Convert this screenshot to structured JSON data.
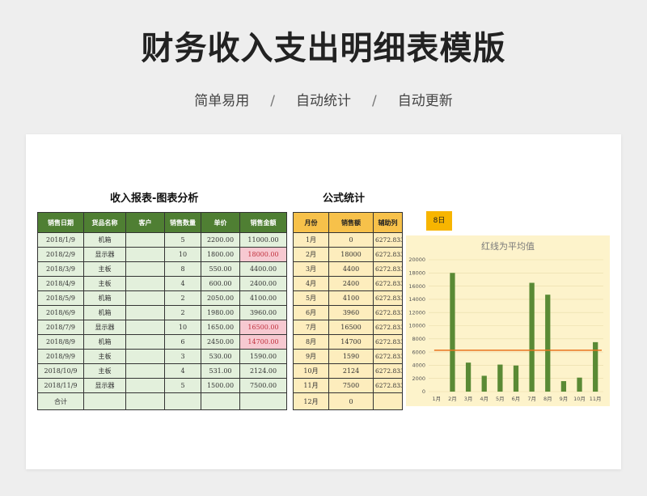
{
  "header": {
    "title": "财务收入支出明细表模版",
    "tags": [
      "简单易用",
      "自动统计",
      "自动更新"
    ],
    "separator": "/"
  },
  "sales_section": {
    "title": "收入报表-图表分析",
    "columns": [
      "销售日期",
      "货品名称",
      "客户",
      "销售数量",
      "单价",
      "销售金额"
    ],
    "rows": [
      {
        "date": "2018/1/9",
        "item": "机箱",
        "customer": "",
        "qty": "5",
        "price": "2200.00",
        "amount": "11000.00",
        "highlight": false
      },
      {
        "date": "2018/2/9",
        "item": "显示器",
        "customer": "",
        "qty": "10",
        "price": "1800.00",
        "amount": "18000.00",
        "highlight": true
      },
      {
        "date": "2018/3/9",
        "item": "主板",
        "customer": "",
        "qty": "8",
        "price": "550.00",
        "amount": "4400.00",
        "highlight": false
      },
      {
        "date": "2018/4/9",
        "item": "主板",
        "customer": "",
        "qty": "4",
        "price": "600.00",
        "amount": "2400.00",
        "highlight": false
      },
      {
        "date": "2018/5/9",
        "item": "机箱",
        "customer": "",
        "qty": "2",
        "price": "2050.00",
        "amount": "4100.00",
        "highlight": false
      },
      {
        "date": "2018/6/9",
        "item": "机箱",
        "customer": "",
        "qty": "2",
        "price": "1980.00",
        "amount": "3960.00",
        "highlight": false
      },
      {
        "date": "2018/7/9",
        "item": "显示器",
        "customer": "",
        "qty": "10",
        "price": "1650.00",
        "amount": "16500.00",
        "highlight": true
      },
      {
        "date": "2018/8/9",
        "item": "机箱",
        "customer": "",
        "qty": "6",
        "price": "2450.00",
        "amount": "14700.00",
        "highlight": true
      },
      {
        "date": "2018/9/9",
        "item": "主板",
        "customer": "",
        "qty": "3",
        "price": "530.00",
        "amount": "1590.00",
        "highlight": false
      },
      {
        "date": "2018/10/9",
        "item": "主板",
        "customer": "",
        "qty": "4",
        "price": "531.00",
        "amount": "2124.00",
        "highlight": false
      },
      {
        "date": "2018/11/9",
        "item": "显示器",
        "customer": "",
        "qty": "5",
        "price": "1500.00",
        "amount": "7500.00",
        "highlight": false
      }
    ],
    "total_label": "合计"
  },
  "formula_section": {
    "title": "公式统计",
    "columns": [
      "月份",
      "销售额",
      "辅助列"
    ],
    "rows": [
      {
        "month": "1月",
        "sales": "0",
        "aux": "6272.833"
      },
      {
        "month": "2月",
        "sales": "18000",
        "aux": "6272.833"
      },
      {
        "month": "3月",
        "sales": "4400",
        "aux": "6272.833"
      },
      {
        "month": "4月",
        "sales": "2400",
        "aux": "6272.833"
      },
      {
        "month": "5月",
        "sales": "4100",
        "aux": "6272.833"
      },
      {
        "month": "6月",
        "sales": "3960",
        "aux": "6272.833"
      },
      {
        "month": "7月",
        "sales": "16500",
        "aux": "6272.833"
      },
      {
        "month": "8月",
        "sales": "14700",
        "aux": "6272.833"
      },
      {
        "month": "9月",
        "sales": "1590",
        "aux": "6272.833"
      },
      {
        "month": "10月",
        "sales": "2124",
        "aux": "6272.833"
      },
      {
        "month": "11月",
        "sales": "7500",
        "aux": "6272.833"
      },
      {
        "month": "12月",
        "sales": "0",
        "aux": ""
      }
    ]
  },
  "month_badge": "8日",
  "colors": {
    "bar": "#5a8a35",
    "avg_line": "#e8731c",
    "chart_bg": "#fdf3cb",
    "sales_header": "#4f7f33",
    "formula_header": "#f7c14a"
  },
  "chart_data": {
    "type": "bar",
    "title": "红线为平均值",
    "categories": [
      "1月",
      "2月",
      "3月",
      "4月",
      "5月",
      "6月",
      "7月",
      "8月",
      "9月",
      "10月",
      "11月"
    ],
    "values": [
      0,
      18000,
      4400,
      2400,
      4100,
      3960,
      16500,
      14700,
      1590,
      2124,
      7500
    ],
    "average": 6272.833,
    "ylim": [
      0,
      20000
    ],
    "yticks": [
      0,
      2000,
      4000,
      6000,
      8000,
      10000,
      12000,
      14000,
      16000,
      18000,
      20000
    ],
    "grid": true,
    "legend": "none"
  }
}
